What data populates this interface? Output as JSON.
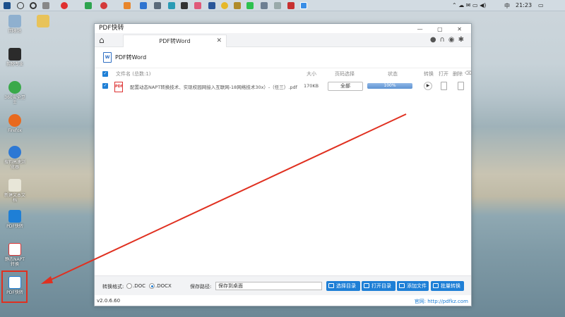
{
  "taskbar": {
    "clock": "21:23",
    "ime": "中",
    "icon_names": [
      "windows-start-icon",
      "search-icon",
      "cortana-icon",
      "folder-icon"
    ]
  },
  "desktop": {
    "icons": [
      {
        "label": "回收站",
        "color": "#8fb0cf"
      },
      {
        "label": "",
        "color": "#e8c35a"
      },
      {
        "label": "剪映专业",
        "color": "#2b2b2b"
      },
      {
        "label": "360安全卫士",
        "color": "#3aa94a"
      },
      {
        "label": "Firefox",
        "color": "#e86a1f"
      },
      {
        "label": "搜狗高速浏览器",
        "color": "#2d78d4"
      },
      {
        "label": "新建文本文档",
        "color": "#e8e6d8"
      },
      {
        "label": "PDF快转",
        "color": "#1e7fd6"
      },
      {
        "label": "静态NAPT转换",
        "color": "#ffffff"
      },
      {
        "label": "PDF快转",
        "color": "#1e7fd6"
      }
    ]
  },
  "window": {
    "title": "PDF快转",
    "tab_label": "PDF转Word",
    "subtitle": "PDF转Word",
    "table": {
      "headers": {
        "name": "文件名 (总数:1)",
        "size": "大小",
        "pages": "页码选择",
        "status": "状态",
        "convert": "转换",
        "open": "打开",
        "delete": "删除"
      },
      "rows": [
        {
          "name": "配置动态NAPT转换技术、实现校园网接入互联网-18网络技术30x）-（任三）.pdf",
          "size": "170KB",
          "pages": "全部",
          "progress_text": "100%",
          "progress": 1.0
        }
      ]
    },
    "bottom": {
      "format_label": "转换格式:",
      "opt_doc": ".DOC",
      "opt_docx": ".DOCX",
      "selected": "docx",
      "save_label": "保存路径:",
      "save_path": "保存到桌面",
      "btn_select": "选择目录",
      "btn_open": "打开目录",
      "btn_add": "添加文件",
      "btn_batch": "批量转换"
    },
    "status": {
      "version": "v2.0.6.60",
      "site": "官网: http://pdfkz.com"
    }
  }
}
